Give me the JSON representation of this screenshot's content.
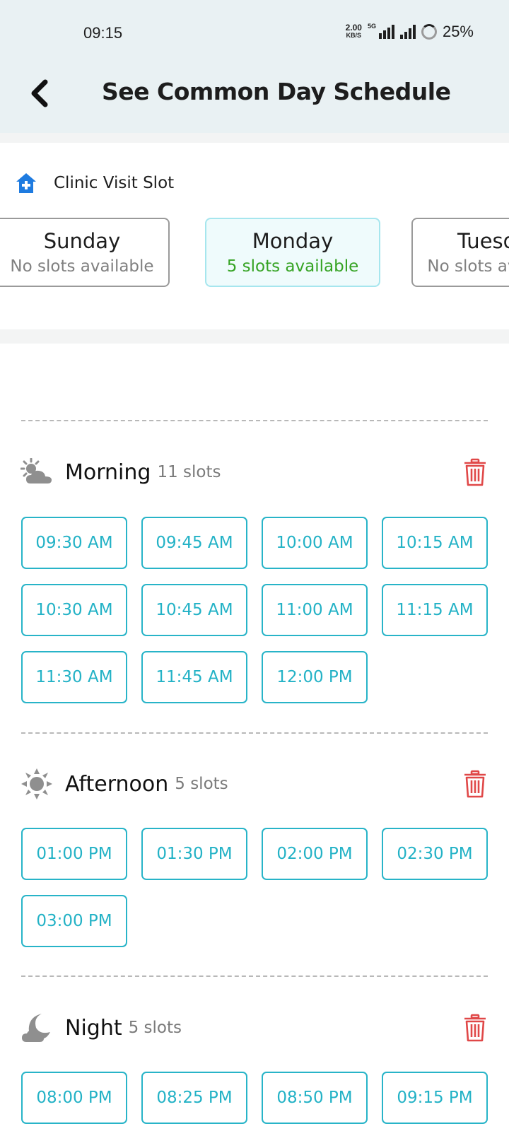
{
  "status_bar": {
    "time": "09:15",
    "net_speed_value": "2.00",
    "net_speed_unit": "KB/S",
    "network_type": "5G",
    "battery": "25%"
  },
  "header": {
    "title": "See Common Day Schedule"
  },
  "clinic": {
    "label": "Clinic Visit Slot"
  },
  "days": [
    {
      "name": "Sunday",
      "slots": "No slots available",
      "selected": false
    },
    {
      "name": "Monday",
      "slots": "5 slots available",
      "selected": true
    },
    {
      "name": "Tuesday",
      "slots": "No slots available",
      "selected": false
    }
  ],
  "sections": {
    "morning": {
      "title": "Morning",
      "count": "11 slots",
      "slots": [
        "09:30 AM",
        "09:45 AM",
        "10:00 AM",
        "10:15 AM",
        "10:30 AM",
        "10:45 AM",
        "11:00 AM",
        "11:15 AM",
        "11:30 AM",
        "11:45 AM",
        "12:00 PM"
      ]
    },
    "afternoon": {
      "title": "Afternoon",
      "count": "5 slots",
      "slots": [
        "01:00 PM",
        "01:30 PM",
        "02:00 PM",
        "02:30 PM",
        "03:00 PM"
      ]
    },
    "night": {
      "title": "Night",
      "count": "5 slots",
      "slots": [
        "08:00 PM",
        "08:25 PM",
        "08:50 PM",
        "09:15 PM"
      ]
    }
  },
  "colors": {
    "header_bg": "#e9f1f3",
    "accent": "#23b2c6",
    "available_green": "#35a323",
    "delete_red": "#e04848",
    "clinic_blue": "#1e7be0"
  }
}
